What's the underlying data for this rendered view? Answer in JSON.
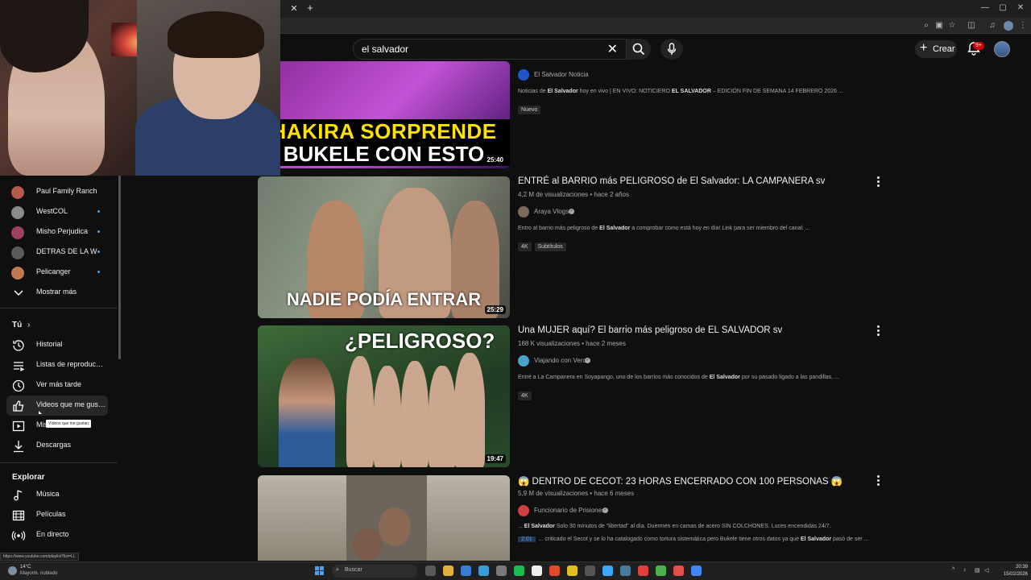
{
  "browser": {
    "tab_close": "✕",
    "tab_new": "+",
    "window_controls": [
      "—",
      "▢",
      "✕"
    ]
  },
  "header": {
    "search_query": "el salvador",
    "search_clear": "✕",
    "create_label": "Crear",
    "notifications_badge": "9+"
  },
  "sidebar": {
    "subscriptions": [
      {
        "name": "Paul Family Ranch",
        "color": "#b85a4a",
        "new": false
      },
      {
        "name": "WestCOL",
        "color": "#8a8a8a",
        "new": true
      },
      {
        "name": "Misho Perjudica",
        "color": "#a04060",
        "new": true
      },
      {
        "name": "DETRAS DE LA W",
        "color": "#5a5a5a",
        "new": true
      },
      {
        "name": "Pelicanger",
        "color": "#c07a50",
        "new": true
      }
    ],
    "show_more": "Mostrar más",
    "you_section": "Tú",
    "you_chevron": "›",
    "you_items": [
      {
        "label": "Historial",
        "icon": "history-icon"
      },
      {
        "label": "Listas de reproducción",
        "icon": "playlists-icon"
      },
      {
        "label": "Ver más tarde",
        "icon": "watch-later-icon"
      },
      {
        "label": "Videos que me gustan",
        "icon": "liked-icon"
      },
      {
        "label": "Mis videos",
        "icon": "my-videos-icon"
      },
      {
        "label": "Descargas",
        "icon": "downloads-icon"
      }
    ],
    "explore_section": "Explorar",
    "explore_items": [
      {
        "label": "Música",
        "icon": "music-icon"
      },
      {
        "label": "Películas",
        "icon": "movies-icon"
      },
      {
        "label": "En directo",
        "icon": "live-icon"
      }
    ],
    "tooltip": "Vídeos que me gustan",
    "status_url": "https://www.youtube.com/playlist?list=LL"
  },
  "results": [
    {
      "thumb_line1": "HAKIRA SORPRENDE",
      "thumb_line2": "BUKELE CON ESTO",
      "duration": "25:40",
      "title": "",
      "meta": "",
      "channel": "El Salvador Noticia",
      "channel_color": "#1e56c8",
      "verified": false,
      "desc_parts": [
        "Noticias de ",
        "El Salvador",
        " hoy en vivo | EN VIVO: NOTICIERO ",
        "EL SALVADOR",
        " – EDICIÓN FIN DE SEMANA 14 FEBRERO 2026 ..."
      ],
      "badges": [
        "Nuevo"
      ]
    },
    {
      "thumb_caption": "NADIE PODÍA ENTRAR",
      "duration": "25:29",
      "title": "ENTRÉ al BARRIO más PELIGROSO de El Salvador: LA CAMPANERA sv",
      "meta": "4,2 M de visualizaciones • hace 2 años",
      "channel": "Araya Vlogs",
      "channel_color": "#7a6a5a",
      "verified": true,
      "desc_parts": [
        "Entro al barrio más peligroso de ",
        "El Salvador",
        " a comprobar como está hoy en día! Link para ser miembro del canal: ..."
      ],
      "badges": [
        "4K",
        "Subtítulos"
      ]
    },
    {
      "thumb_caption": "¿PELIGROSO?",
      "duration": "19:47",
      "title": "Una MUJER aquí? El barrio más peligroso de EL SALVADOR sv",
      "meta": "168 K visualizaciones • hace 2 meses",
      "channel": "Viajando con Vero",
      "channel_color": "#4aa3c8",
      "verified": true,
      "desc_parts": [
        "Entré a La Campanera en Soyapango, uno de los barrios más conocidos de ",
        "El Salvador",
        " por su pasado ligado a las pandillas, ..."
      ],
      "badges": [
        "4K"
      ]
    },
    {
      "duration": "",
      "title": "😱 DENTRO DE CECOT: 23 HORAS ENCERRADO CON 100 PERSONAS 😱",
      "meta": "5,9 M de visualizaciones • hace 6 meses",
      "channel": "Funcionario de Prisiones",
      "channel_color": "#d04040",
      "verified": true,
      "desc_parts": [
        "... ",
        "El Salvador",
        " Solo 30 minutos de \"libertad\" al día. Duermen en camas de acero SIN COLCHONES. Luces encendidas 24/7."
      ],
      "chapter_time": "2:01",
      "chapter_parts": [
        "... criticado el Secot y se lo ha catalogado como tortura sistemática pero Bukele tiene otros datos ya que ",
        "El Salvador",
        " pasó de ser ..."
      ]
    }
  ],
  "taskbar": {
    "temperature": "14°C",
    "weather": "Mayorm. nublado",
    "search_label": "Buscar",
    "time": "20:39",
    "date": "15/02/2026",
    "apps": [
      "#5a5a5a",
      "#e0b040",
      "#3a7bd5",
      "#3a9bd5",
      "#7a7a7a",
      "#1db954",
      "#eeeeee",
      "#e04a2a",
      "#e0c020",
      "#555555",
      "#3ea6ff",
      "#4a7a9a",
      "#e04040",
      "#4caf50",
      "#e05050",
      "#4285f4"
    ]
  }
}
